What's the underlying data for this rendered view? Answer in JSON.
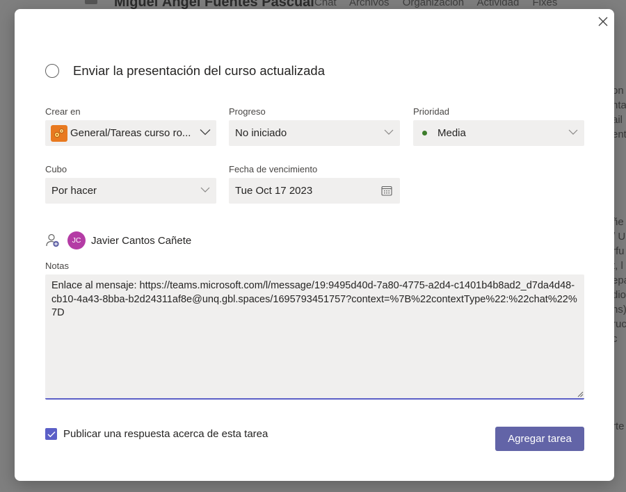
{
  "background": {
    "title": "Miguel Ángel Fuentes Pascual",
    "tabs": [
      "Chat",
      "Archivos",
      "Organización",
      "Actividad",
      "Fixes"
    ],
    "right_fragments": [
      "on",
      "nta",
      "ail",
      "ent",
      "",
      "",
      "",
      "",
      "",
      "ñe",
      "/ U",
      "rfu",
      "t, l",
      "epa",
      "dio",
      "ns)",
      "ruc",
      "c",
      "",
      "",
      "",
      "",
      "",
      "rte"
    ]
  },
  "modal": {
    "close_icon": "close-icon",
    "task": {
      "title": "Enviar la presentación del curso actualizada",
      "completion_icon": "circle-outline-icon"
    },
    "fields": {
      "crear_en": {
        "label": "Crear en",
        "value": "General/Tareas curso ro...",
        "icon": "planner-gear-icon"
      },
      "progreso": {
        "label": "Progreso",
        "value": "No iniciado"
      },
      "prioridad": {
        "label": "Prioridad",
        "value": "Media",
        "dot_color": "#3d7d2c"
      },
      "cubo": {
        "label": "Cubo",
        "value": "Por hacer"
      },
      "fecha": {
        "label": "Fecha de vencimiento",
        "value": "Tue Oct 17 2023",
        "icon": "calendar-icon"
      }
    },
    "assignment": {
      "assign_icon": "add-person-icon",
      "avatar_initials": "JC",
      "avatar_color": "#b43ca5",
      "assignee": "Javier Cantos Cañete"
    },
    "notes": {
      "label": "Notas",
      "value": "Enlace al mensaje: https://teams.microsoft.com/l/message/19:9495d40d-7a80-4775-a2d4-c1401b4b8ad2_d7da4d48-cb10-4a43-8bba-b2d24311af8e@unq.gbl.spaces/1695793451757?context=%7B%22contextType%22:%22chat%22%7D"
    },
    "publish": {
      "checked": true,
      "label": "Publicar una respuesta acerca de esta tarea"
    },
    "add_button": "Agregar tarea",
    "accent_color": "#6264a7"
  }
}
